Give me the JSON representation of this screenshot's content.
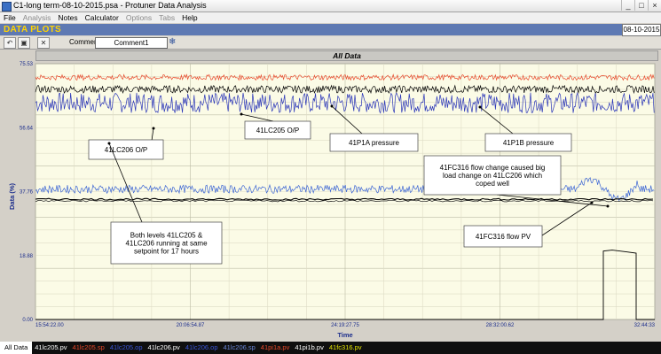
{
  "window": {
    "title": "C1-long term-08-10-2015.psa - Protuner Data Analysis",
    "controls": [
      "_",
      "□",
      "×"
    ]
  },
  "menu": [
    {
      "label": "File",
      "enabled": true
    },
    {
      "label": "Analysis",
      "enabled": false
    },
    {
      "label": "Notes",
      "enabled": true
    },
    {
      "label": "Calculator",
      "enabled": true
    },
    {
      "label": "Options",
      "enabled": false
    },
    {
      "label": "Tabs",
      "enabled": false
    },
    {
      "label": "Help",
      "enabled": true
    }
  ],
  "header": {
    "title": "DATA PLOTS",
    "date": "08-10-2015"
  },
  "toolbar": {
    "comment_label": "Comment",
    "comment_value": "Comment1"
  },
  "chart_data": {
    "type": "line",
    "title": "All Data",
    "xlabel": "Time",
    "ylabel": "Data (%)",
    "ylim": [
      0.0,
      75.53
    ],
    "y_ticks": [
      "0.00",
      "18.88",
      "37.76",
      "56.64",
      "75.53"
    ],
    "x_ticks": [
      "15:54:22.00",
      "20:06:54.87",
      "24:19:27.75",
      "28:32:00.62",
      "32:44:33"
    ],
    "grid": true,
    "series": [
      {
        "name": "41pi1a.pv",
        "color": "#e8482a",
        "approx_level": 71.5
      },
      {
        "name": "41pi1b.pv",
        "color": "#000000",
        "approx_level": 68.0
      },
      {
        "name": "41lc205.op",
        "color": "#2a35b8",
        "approx_level": 64.0
      },
      {
        "name": "41lc206.op",
        "color": "#3d66d4",
        "approx_level": 38.5
      },
      {
        "name": "41lc205.pv",
        "color": "#000000",
        "approx_level": 35.5
      },
      {
        "name": "41fc316.pv",
        "color": "#000000",
        "approx_level": 0.0,
        "step_level": 20.2
      },
      {
        "name": "41lc206.pv",
        "color": "#1a1a1a",
        "approx_level": 35.0
      }
    ],
    "annotations": [
      {
        "text": [
          "41LC205 O/P"
        ]
      },
      {
        "text": [
          "41P1A pressure"
        ]
      },
      {
        "text": [
          "41P1B pressure"
        ]
      },
      {
        "text": [
          "41LC206 O/P"
        ]
      },
      {
        "text": [
          "Both levels 41LC205 &",
          "41LC206 running at same",
          "setpoint for 17 hours"
        ]
      },
      {
        "text": [
          "41FC316 flow change caused big",
          "load change on 41LC206 which",
          "coped well"
        ]
      },
      {
        "text": [
          "41FC316 flow PV"
        ]
      }
    ]
  },
  "tabs": [
    {
      "label": "All Data",
      "color": "#000000",
      "active": true
    },
    {
      "label": "41lc205.pv",
      "color": "#ffffff",
      "active": false
    },
    {
      "label": "41lc205.sp",
      "color": "#e8482a",
      "active": false
    },
    {
      "label": "41lc205.op",
      "color": "#3a55d8",
      "active": false
    },
    {
      "label": "41lc206.pv",
      "color": "#ffffff",
      "active": false
    },
    {
      "label": "41lc206.op",
      "color": "#3a55d8",
      "active": false
    },
    {
      "label": "41lc206.sp",
      "color": "#6a86d8",
      "active": false
    },
    {
      "label": "41pi1a.pv",
      "color": "#e8482a",
      "active": false
    },
    {
      "label": "41pi1b.pv",
      "color": "#ffffff",
      "active": false
    },
    {
      "label": "41fc316.pv",
      "color": "#e6e600",
      "active": false
    }
  ]
}
